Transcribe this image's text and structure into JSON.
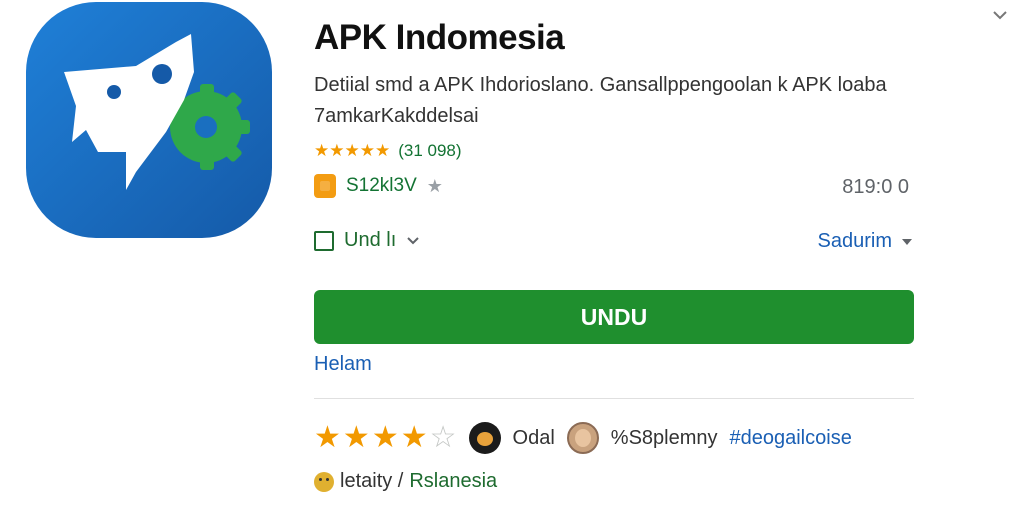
{
  "app": {
    "title": "APK Indomesia",
    "description": "Detiial smd a APK Ihdorioslano. Gansallppengoolan k APK loaba 7amkarKakddelsai",
    "rating_stars": 5,
    "rating_count": "(31 098)",
    "developer": "S12kl3V",
    "price": "819:0 0"
  },
  "icon": {
    "name": "app-logo",
    "bg": "#1f6fc4",
    "accent": "#2fa84a"
  },
  "filters": {
    "checkbox_label": "Und lı",
    "sort_label": "Sadurim"
  },
  "actions": {
    "install_label": "UNDU",
    "install_color": "#1f8f2e",
    "link_label": "Helam"
  },
  "review": {
    "stars": 4,
    "max_stars": 5,
    "reviewer1": "Odal",
    "reviewer2": "%S8plemny",
    "hashtag": "#deogailcoise"
  },
  "footer": {
    "text_a": "letaity /",
    "text_b": "Rslanesia"
  },
  "top": {
    "chevron": "chevron-down-icon"
  }
}
